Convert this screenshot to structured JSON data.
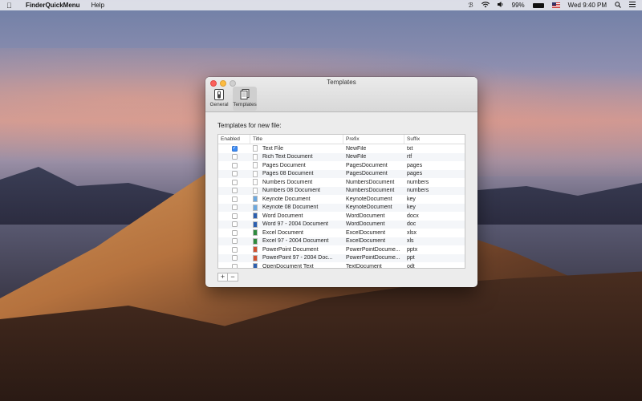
{
  "menubar": {
    "app_name": "FinderQuickMenu",
    "help_label": "Help",
    "battery_text": "99%",
    "battery_level": 0.99,
    "clock": "Wed 9:40 PM"
  },
  "window": {
    "title": "Templates",
    "tabs": [
      {
        "label": "General",
        "icon": "general-switch-icon"
      },
      {
        "label": "Templates",
        "icon": "templates-docs-icon"
      }
    ],
    "heading": "Templates for new file:",
    "columns": {
      "enabled": "Enabled",
      "title": "Title",
      "prefix": "Prefix",
      "suffix": "Suffix"
    },
    "rows": [
      {
        "title": "Text File",
        "prefix": "NewFile",
        "suffix": "txt",
        "enabled": true,
        "icon_color": "#ffffff"
      },
      {
        "title": "Rich Text Document",
        "prefix": "NewFile",
        "suffix": "rtf",
        "enabled": false,
        "icon_color": "#ffffff"
      },
      {
        "title": "Pages Document",
        "prefix": "PagesDocument",
        "suffix": "pages",
        "enabled": false,
        "icon_color": "#ffffff"
      },
      {
        "title": "Pages 08 Document",
        "prefix": "PagesDocument",
        "suffix": "pages",
        "enabled": false,
        "icon_color": "#ffffff"
      },
      {
        "title": "Numbers Document",
        "prefix": "NumbersDocument",
        "suffix": "numbers",
        "enabled": false,
        "icon_color": "#ffffff"
      },
      {
        "title": "Numbers 08 Document",
        "prefix": "NumbersDocument",
        "suffix": "numbers",
        "enabled": false,
        "icon_color": "#ffffff"
      },
      {
        "title": "Keynote Document",
        "prefix": "KeynoteDocument",
        "suffix": "key",
        "enabled": false,
        "icon_color": "#6aa8e0"
      },
      {
        "title": "Keynote 08 Document",
        "prefix": "KeynoteDocument",
        "suffix": "key",
        "enabled": false,
        "icon_color": "#6aa8e0"
      },
      {
        "title": "Word Document",
        "prefix": "WordDocument",
        "suffix": "docx",
        "enabled": false,
        "icon_color": "#2b5fb0"
      },
      {
        "title": "Word 97 - 2004 Document",
        "prefix": "WordDocument",
        "suffix": "doc",
        "enabled": false,
        "icon_color": "#2b5fb0"
      },
      {
        "title": "Excel Document",
        "prefix": "ExcelDocument",
        "suffix": "xlsx",
        "enabled": false,
        "icon_color": "#2e8b3e"
      },
      {
        "title": "Excel 97 - 2004 Document",
        "prefix": "ExcelDocument",
        "suffix": "xls",
        "enabled": false,
        "icon_color": "#2e8b3e"
      },
      {
        "title": "PowerPoint Document",
        "prefix": "PowerPointDocume...",
        "suffix": "pptx",
        "enabled": false,
        "icon_color": "#d2502f"
      },
      {
        "title": "PowerPoint 97 - 2004 Doc...",
        "prefix": "PowerPointDocume...",
        "suffix": "ppt",
        "enabled": false,
        "icon_color": "#d2502f"
      },
      {
        "title": "OpenDocument Text",
        "prefix": "TextDocument",
        "suffix": "odt",
        "enabled": false,
        "icon_color": "#2b5fb0"
      }
    ],
    "add_label": "+",
    "remove_label": "−"
  }
}
